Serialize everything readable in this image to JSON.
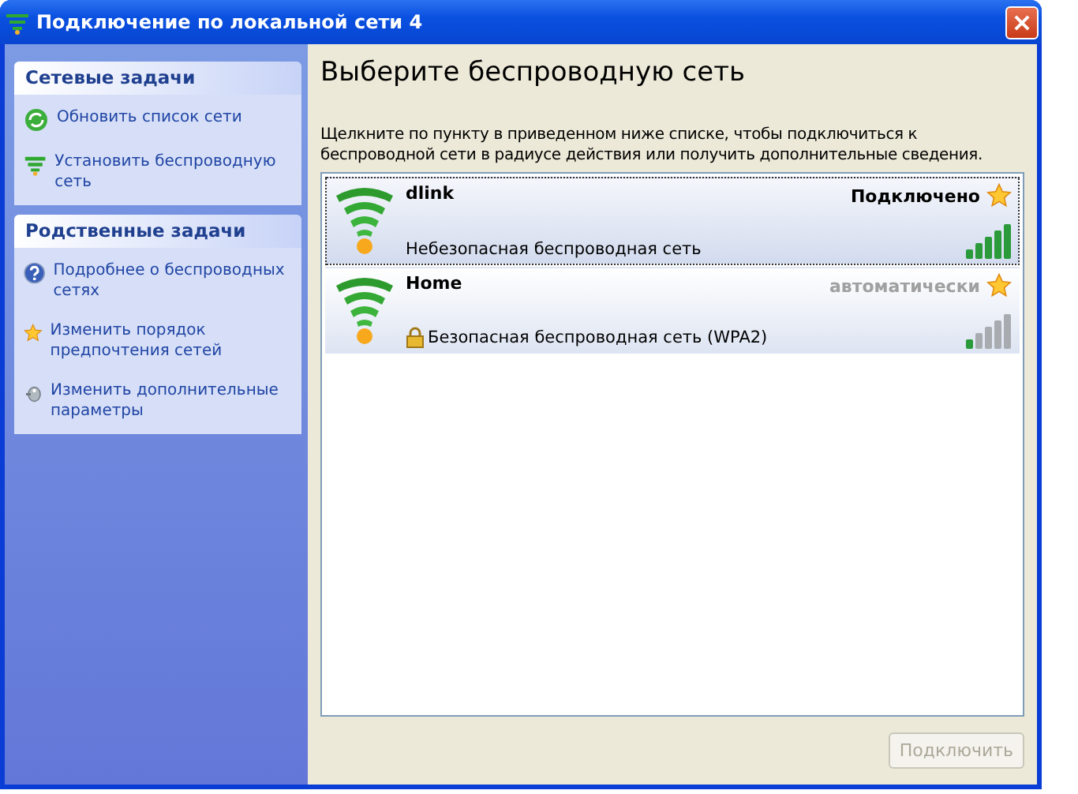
{
  "window": {
    "title": "Подключение по локальной сети 4"
  },
  "sidebar": {
    "panels": [
      {
        "title": "Сетевые задачи",
        "items": [
          {
            "label": "Обновить список сети",
            "kind": "refresh"
          },
          {
            "label": "Установить беспроводную сеть",
            "kind": "wireless"
          }
        ]
      },
      {
        "title": "Родственные задачи",
        "items": [
          {
            "label": "Подробнее о беспроводных сетях",
            "kind": "help"
          },
          {
            "label": "Изменить порядок предпочтения  сетей",
            "kind": "star"
          },
          {
            "label": "Изменить дополнительные параметры",
            "kind": "settings"
          }
        ]
      }
    ]
  },
  "content": {
    "heading": "Выберите беспроводную сеть",
    "description": "Щелкните по пункту в приведенном ниже списке, чтобы подключиться к беспроводной сети в радиусе действия или получить дополнительные сведения.",
    "networks": [
      {
        "name": "dlink",
        "status": "Подключено",
        "connected": true,
        "selected": true,
        "secured": false,
        "weak_signal": false,
        "security": "Небезопасная беспроводная сеть"
      },
      {
        "name": "Home",
        "status": "автоматически",
        "connected": false,
        "selected": false,
        "secured": true,
        "weak_signal": true,
        "security": "Безопасная беспроводная сеть (WPA2)"
      }
    ],
    "connect_button": {
      "label": "Подключить",
      "disabled": true
    }
  }
}
